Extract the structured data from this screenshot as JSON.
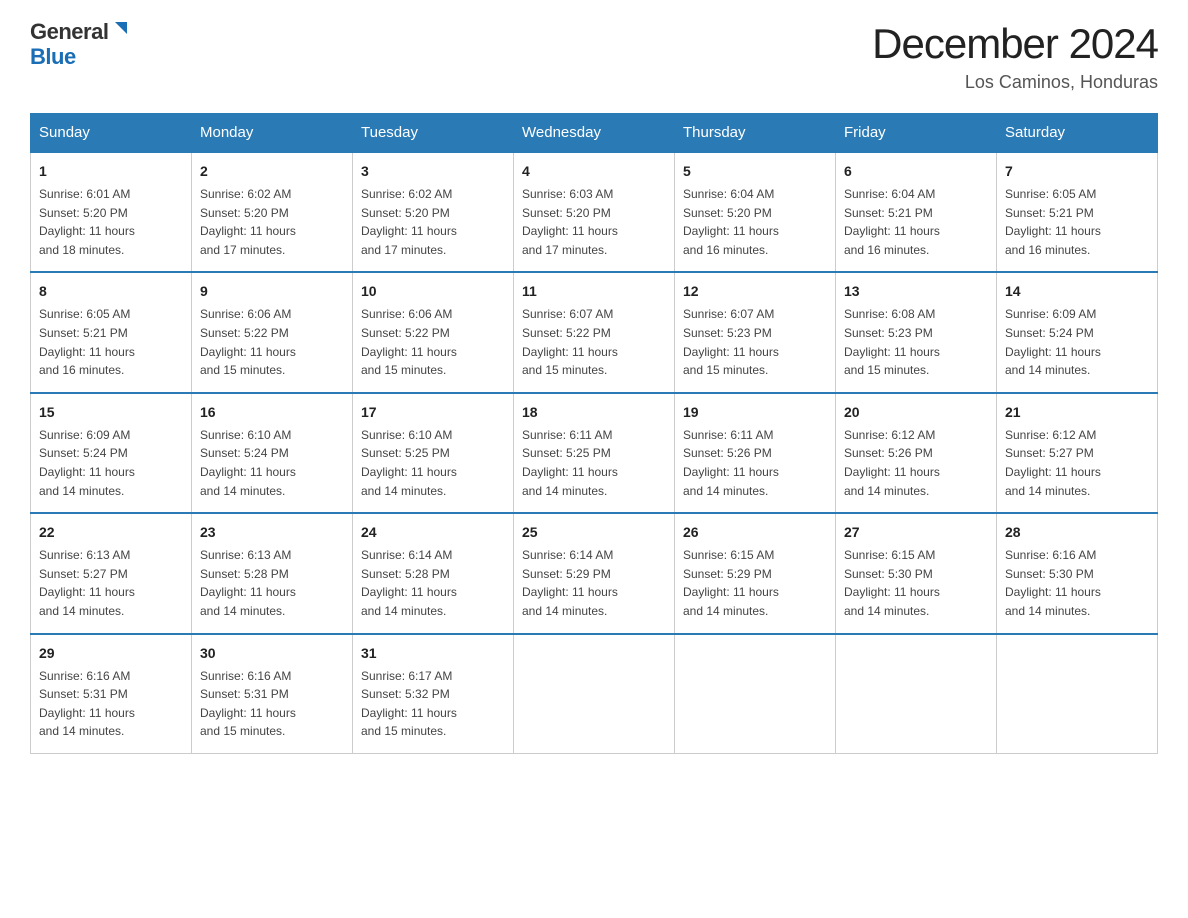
{
  "logo": {
    "general": "General",
    "blue": "Blue"
  },
  "title": {
    "month_year": "December 2024",
    "location": "Los Caminos, Honduras"
  },
  "headers": [
    "Sunday",
    "Monday",
    "Tuesday",
    "Wednesday",
    "Thursday",
    "Friday",
    "Saturday"
  ],
  "weeks": [
    [
      {
        "day": "1",
        "sunrise": "6:01 AM",
        "sunset": "5:20 PM",
        "daylight": "11 hours and 18 minutes."
      },
      {
        "day": "2",
        "sunrise": "6:02 AM",
        "sunset": "5:20 PM",
        "daylight": "11 hours and 17 minutes."
      },
      {
        "day": "3",
        "sunrise": "6:02 AM",
        "sunset": "5:20 PM",
        "daylight": "11 hours and 17 minutes."
      },
      {
        "day": "4",
        "sunrise": "6:03 AM",
        "sunset": "5:20 PM",
        "daylight": "11 hours and 17 minutes."
      },
      {
        "day": "5",
        "sunrise": "6:04 AM",
        "sunset": "5:20 PM",
        "daylight": "11 hours and 16 minutes."
      },
      {
        "day": "6",
        "sunrise": "6:04 AM",
        "sunset": "5:21 PM",
        "daylight": "11 hours and 16 minutes."
      },
      {
        "day": "7",
        "sunrise": "6:05 AM",
        "sunset": "5:21 PM",
        "daylight": "11 hours and 16 minutes."
      }
    ],
    [
      {
        "day": "8",
        "sunrise": "6:05 AM",
        "sunset": "5:21 PM",
        "daylight": "11 hours and 16 minutes."
      },
      {
        "day": "9",
        "sunrise": "6:06 AM",
        "sunset": "5:22 PM",
        "daylight": "11 hours and 15 minutes."
      },
      {
        "day": "10",
        "sunrise": "6:06 AM",
        "sunset": "5:22 PM",
        "daylight": "11 hours and 15 minutes."
      },
      {
        "day": "11",
        "sunrise": "6:07 AM",
        "sunset": "5:22 PM",
        "daylight": "11 hours and 15 minutes."
      },
      {
        "day": "12",
        "sunrise": "6:07 AM",
        "sunset": "5:23 PM",
        "daylight": "11 hours and 15 minutes."
      },
      {
        "day": "13",
        "sunrise": "6:08 AM",
        "sunset": "5:23 PM",
        "daylight": "11 hours and 15 minutes."
      },
      {
        "day": "14",
        "sunrise": "6:09 AM",
        "sunset": "5:24 PM",
        "daylight": "11 hours and 14 minutes."
      }
    ],
    [
      {
        "day": "15",
        "sunrise": "6:09 AM",
        "sunset": "5:24 PM",
        "daylight": "11 hours and 14 minutes."
      },
      {
        "day": "16",
        "sunrise": "6:10 AM",
        "sunset": "5:24 PM",
        "daylight": "11 hours and 14 minutes."
      },
      {
        "day": "17",
        "sunrise": "6:10 AM",
        "sunset": "5:25 PM",
        "daylight": "11 hours and 14 minutes."
      },
      {
        "day": "18",
        "sunrise": "6:11 AM",
        "sunset": "5:25 PM",
        "daylight": "11 hours and 14 minutes."
      },
      {
        "day": "19",
        "sunrise": "6:11 AM",
        "sunset": "5:26 PM",
        "daylight": "11 hours and 14 minutes."
      },
      {
        "day": "20",
        "sunrise": "6:12 AM",
        "sunset": "5:26 PM",
        "daylight": "11 hours and 14 minutes."
      },
      {
        "day": "21",
        "sunrise": "6:12 AM",
        "sunset": "5:27 PM",
        "daylight": "11 hours and 14 minutes."
      }
    ],
    [
      {
        "day": "22",
        "sunrise": "6:13 AM",
        "sunset": "5:27 PM",
        "daylight": "11 hours and 14 minutes."
      },
      {
        "day": "23",
        "sunrise": "6:13 AM",
        "sunset": "5:28 PM",
        "daylight": "11 hours and 14 minutes."
      },
      {
        "day": "24",
        "sunrise": "6:14 AM",
        "sunset": "5:28 PM",
        "daylight": "11 hours and 14 minutes."
      },
      {
        "day": "25",
        "sunrise": "6:14 AM",
        "sunset": "5:29 PM",
        "daylight": "11 hours and 14 minutes."
      },
      {
        "day": "26",
        "sunrise": "6:15 AM",
        "sunset": "5:29 PM",
        "daylight": "11 hours and 14 minutes."
      },
      {
        "day": "27",
        "sunrise": "6:15 AM",
        "sunset": "5:30 PM",
        "daylight": "11 hours and 14 minutes."
      },
      {
        "day": "28",
        "sunrise": "6:16 AM",
        "sunset": "5:30 PM",
        "daylight": "11 hours and 14 minutes."
      }
    ],
    [
      {
        "day": "29",
        "sunrise": "6:16 AM",
        "sunset": "5:31 PM",
        "daylight": "11 hours and 14 minutes."
      },
      {
        "day": "30",
        "sunrise": "6:16 AM",
        "sunset": "5:31 PM",
        "daylight": "11 hours and 15 minutes."
      },
      {
        "day": "31",
        "sunrise": "6:17 AM",
        "sunset": "5:32 PM",
        "daylight": "11 hours and 15 minutes."
      },
      null,
      null,
      null,
      null
    ]
  ],
  "labels": {
    "sunrise": "Sunrise:",
    "sunset": "Sunset:",
    "daylight": "Daylight:"
  }
}
